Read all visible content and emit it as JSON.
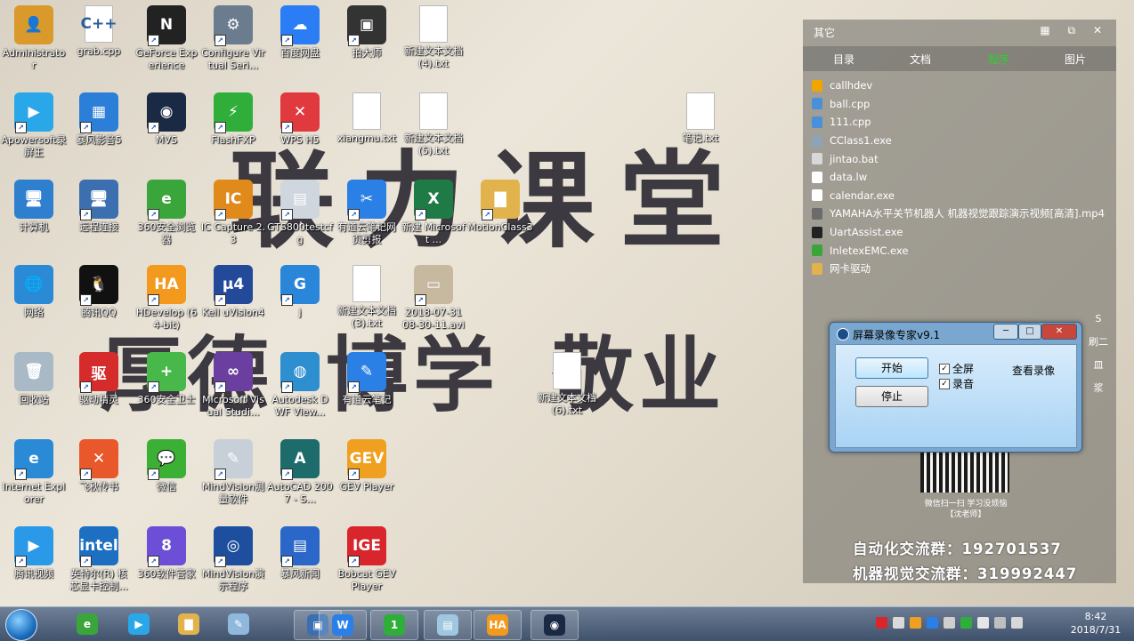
{
  "wallpaper": {
    "line1": "联力课堂",
    "line2": "厚德 博学 敬业"
  },
  "desktop_icons": [
    {
      "label": "Administrator",
      "color": "#d99a2b",
      "glyph": "👤"
    },
    {
      "label": "grab.cpp",
      "color": "#ffffff",
      "glyph": "C++",
      "file": true
    },
    {
      "label": "GeForce Experience",
      "color": "#222222",
      "glyph": "N"
    },
    {
      "label": "Configure Virtual Seri...",
      "color": "#6a7c8e",
      "glyph": "⚙"
    },
    {
      "label": "百度网盘",
      "color": "#2a7df4",
      "glyph": "☁"
    },
    {
      "label": "拍大师",
      "color": "#333333",
      "glyph": "▣"
    },
    {
      "label": "新建文本文档 (4).txt",
      "color": "#ffffff",
      "glyph": "",
      "file": true
    },
    {
      "label": "Apowersoft录屏王",
      "color": "#2aa7e8",
      "glyph": "▶"
    },
    {
      "label": "暴风影音5",
      "color": "#2b7fd9",
      "glyph": "▦"
    },
    {
      "label": "MVS",
      "color": "#1b2a44",
      "glyph": "◉"
    },
    {
      "label": "FlashFXP",
      "color": "#2fae3a",
      "glyph": "⚡"
    },
    {
      "label": "WPS H5",
      "color": "#e0393e",
      "glyph": "✕"
    },
    {
      "label": "xiangmu.txt",
      "color": "#ffffff",
      "glyph": "",
      "file": true
    },
    {
      "label": "新建文本文档 (5).txt",
      "color": "#ffffff",
      "glyph": "",
      "file": true
    },
    {
      "label": "笔记.txt",
      "color": "#ffffff",
      "glyph": "",
      "file": true
    },
    {
      "label": "计算机",
      "color": "#2f7fcf",
      "glyph": "🖥"
    },
    {
      "label": "远程连接",
      "color": "#3b6fb0",
      "glyph": "🖥"
    },
    {
      "label": "360安全浏览器",
      "color": "#3aa53a",
      "glyph": "e"
    },
    {
      "label": "IC Capture 2.3",
      "color": "#e08a1c",
      "glyph": "IC"
    },
    {
      "label": "GTS800testcfg",
      "color": "#cfd6de",
      "glyph": "▤"
    },
    {
      "label": "有道云笔记网页剪报",
      "color": "#2b80e6",
      "glyph": "✂"
    },
    {
      "label": "新建 Microsoft ...",
      "color": "#1f7b45",
      "glyph": "X"
    },
    {
      "label": "MotionClass3",
      "color": "#e2b34c",
      "glyph": "▇"
    },
    {
      "label": "网络",
      "color": "#2a8ad6",
      "glyph": "🌐"
    },
    {
      "label": "腾讯QQ",
      "color": "#111111",
      "glyph": "🐧"
    },
    {
      "label": "HDevelop (64-bit)",
      "color": "#f39a1e",
      "glyph": "HA"
    },
    {
      "label": "Keil uVision4",
      "color": "#234a99",
      "glyph": "μ4"
    },
    {
      "label": "j",
      "color": "#2a86d8",
      "glyph": "G"
    },
    {
      "label": "新建文本文档 (3).txt",
      "color": "#ffffff",
      "glyph": "",
      "file": true
    },
    {
      "label": "2018-07-31 08-30-11.avi",
      "color": "#c7b9a0",
      "glyph": "▭"
    },
    {
      "label": "回收站",
      "color": "#a9b9c6",
      "glyph": "🗑"
    },
    {
      "label": "驱动精灵",
      "color": "#d62b2b",
      "glyph": "驱"
    },
    {
      "label": "360安全卫士",
      "color": "#48b84a",
      "glyph": "+"
    },
    {
      "label": "Microsoft Visual Studi...",
      "color": "#6b3fa0",
      "glyph": "∞"
    },
    {
      "label": "Autodesk DWF View...",
      "color": "#2d8fd0",
      "glyph": "◍"
    },
    {
      "label": "有道云笔记",
      "color": "#2b80e6",
      "glyph": "✎"
    },
    {
      "label": "新建文本文档 (6).txt",
      "color": "#ffffff",
      "glyph": "",
      "file": true
    },
    {
      "label": "Internet Explorer",
      "color": "#2a8ad6",
      "glyph": "e"
    },
    {
      "label": "飞秋传书",
      "color": "#e8582a",
      "glyph": "✕"
    },
    {
      "label": "微信",
      "color": "#3cb034",
      "glyph": "💬"
    },
    {
      "label": "MindVision测量软件",
      "color": "#c7cfd8",
      "glyph": "✎"
    },
    {
      "label": "AutoCAD 2007 - S...",
      "color": "#1e6b6b",
      "glyph": "A"
    },
    {
      "label": "GEV Player",
      "color": "#f0a020",
      "glyph": "GEV"
    },
    {
      "label": "腾讯视频",
      "color": "#2a9ae8",
      "glyph": "▶"
    },
    {
      "label": "英特尔(R) 核芯显卡控制...",
      "color": "#1c6fc1",
      "glyph": "intel"
    },
    {
      "label": "360软件管家",
      "color": "#6c4fd6",
      "glyph": "8"
    },
    {
      "label": "MindVision演示程序",
      "color": "#1e4f9e",
      "glyph": "◎"
    },
    {
      "label": "暴风新闻",
      "color": "#2b67c9",
      "glyph": "▤"
    },
    {
      "label": "Bobcat GEV Player",
      "color": "#d8262c",
      "glyph": "IGE"
    }
  ],
  "panel": {
    "title": "其它",
    "tabs": [
      "目录",
      "文档",
      "程序",
      "图片"
    ],
    "active_tab": "程序",
    "files": [
      {
        "name": "callhdev",
        "color": "#f0a500"
      },
      {
        "name": "ball.cpp",
        "color": "#4a90d9"
      },
      {
        "name": "111.cpp",
        "color": "#4a90d9"
      },
      {
        "name": "CClass1.exe",
        "color": "#8fa3b8"
      },
      {
        "name": "jintao.bat",
        "color": "#d8d8d8"
      },
      {
        "name": "data.lw",
        "color": "#ffffff"
      },
      {
        "name": "calendar.exe",
        "color": "#ffffff"
      },
      {
        "name": "YAMAHA水平关节机器人 机器视觉跟踪演示视频[高清].mp4",
        "color": "#6b6b6b"
      },
      {
        "name": "UartAssist.exe",
        "color": "#222222"
      },
      {
        "name": "InletexEMC.exe",
        "color": "#3aa53a"
      },
      {
        "name": "网卡驱动",
        "color": "#e2b34c"
      }
    ],
    "qr_caption_1": "微信扫一扫 学习没烦恼",
    "qr_caption_2": "【沈老师】",
    "group_1": "自动化交流群：192701537",
    "group_2": "机器视觉交流群：319992447"
  },
  "recorder": {
    "title": "屏幕录像专家v9.1",
    "start_label": "开始",
    "stop_label": "停止",
    "fullscreen_label": "全屏",
    "audio_label": "录音",
    "view_label": "查看录像",
    "minimize": "─",
    "maximize": "□",
    "close": "✕"
  },
  "taskbar": {
    "apps": [
      {
        "name": "360-browser",
        "color": "#3aa53a",
        "glyph": "e"
      },
      {
        "name": "apowersoft",
        "color": "#2aa7e8",
        "glyph": "▶"
      },
      {
        "name": "explorer",
        "color": "#e2b34c",
        "glyph": "▇"
      },
      {
        "name": "paint",
        "color": "#8fb8dc",
        "glyph": "✎"
      },
      {
        "name": "screen-recorder",
        "color": "#3b6fb0",
        "glyph": "▣"
      },
      {
        "name": "wps",
        "color": "#2a80e6",
        "glyph": "W"
      },
      {
        "name": "notepad-green",
        "color": "#2fae3a",
        "glyph": "1"
      },
      {
        "name": "gts",
        "color": "#9fc7e0",
        "glyph": "▤"
      },
      {
        "name": "hdevelop",
        "color": "#f39a1e",
        "glyph": "HA"
      },
      {
        "name": "mvs",
        "color": "#1b2a44",
        "glyph": "◉"
      }
    ],
    "time": "8:42",
    "date": "2018/7/31"
  },
  "side_rail": [
    "S",
    "刷二",
    "皿",
    "浆"
  ]
}
